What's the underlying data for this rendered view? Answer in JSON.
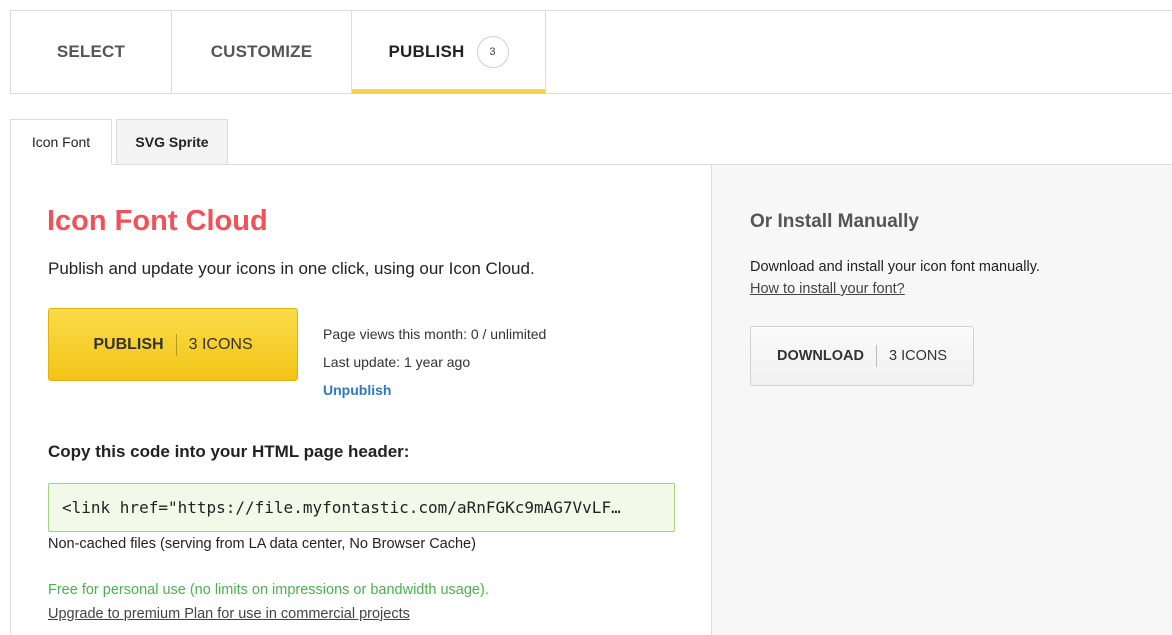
{
  "steps": {
    "select": "SELECT",
    "customize": "CUSTOMIZE",
    "publish": "PUBLISH",
    "publish_badge": "3"
  },
  "subtabs": {
    "icon_font": "Icon Font",
    "svg_sprite": "SVG Sprite"
  },
  "cloud": {
    "title": "Icon Font Cloud",
    "lead": "Publish and update your icons in one click, using our Icon Cloud.",
    "publish_label": "PUBLISH",
    "publish_count": "3 ICONS",
    "page_views": "Page views this month: 0 / unlimited",
    "last_update": "Last update: 1 year ago",
    "unpublish": "Unpublish",
    "copy_label": "Copy this code into your HTML page header:",
    "code": "<link href=\"https://file.myfontastic.com/aRnFGKc9mAG7VvLF…",
    "noncached": "Non-cached files (serving from LA data center, No Browser Cache)",
    "free": "Free for personal use (no limits on impressions or bandwidth usage).",
    "upgrade": "Upgrade to premium Plan for use in commercial projects"
  },
  "manual": {
    "title": "Or Install Manually",
    "desc": "Download and install your icon font manually.",
    "howto": "How to install your font?",
    "download_label": "DOWNLOAD",
    "download_count": "3 ICONS"
  },
  "colors": {
    "accent_yellow": "#f5d44a",
    "title_red": "#f0525a",
    "link_blue": "#2d78c4",
    "free_green": "#4caf50"
  }
}
